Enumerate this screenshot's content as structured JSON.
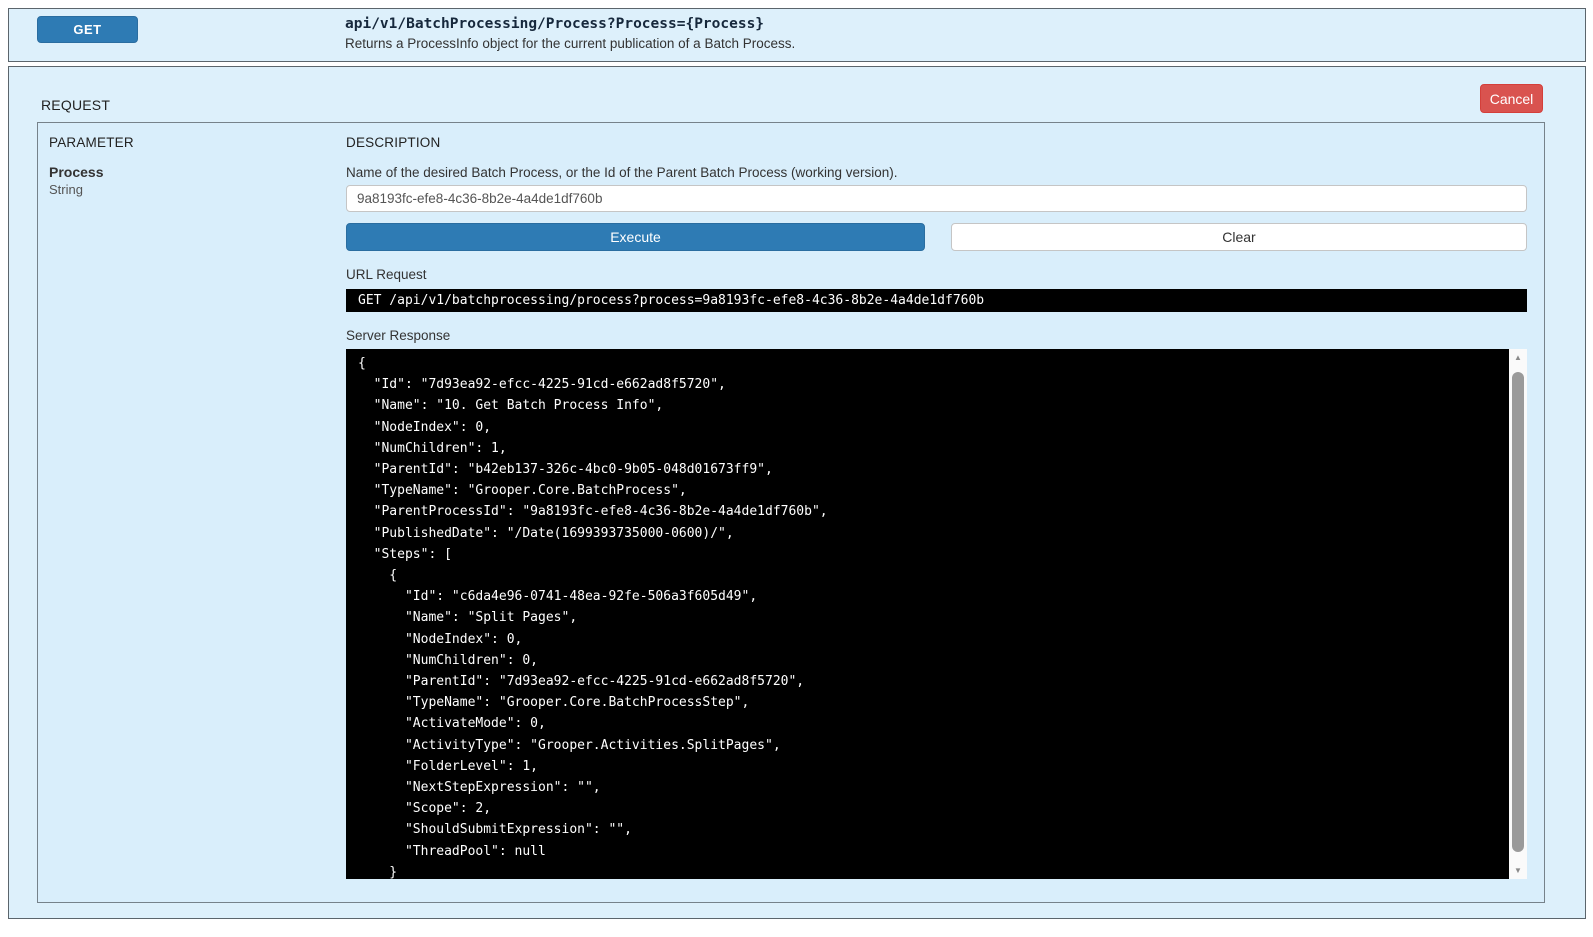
{
  "operation": {
    "method": "GET",
    "path": "api/v1/BatchProcessing/Process?Process={Process}",
    "summary": "Returns a ProcessInfo object for the current publication of a Batch Process."
  },
  "request": {
    "section_label": "REQUEST",
    "cancel_label": "Cancel",
    "table": {
      "parameter_header": "PARAMETER",
      "description_header": "DESCRIPTION",
      "parameter": {
        "name": "Process",
        "type": "String",
        "description": "Name of the desired Batch Process, or the Id of the Parent Batch Process (working version).",
        "value": "9a8193fc-efe8-4c36-8b2e-4a4de1df760b"
      }
    },
    "execute_label": "Execute",
    "clear_label": "Clear",
    "url_request_label": "URL Request",
    "url_request": "GET /api/v1/batchprocessing/process?process=9a8193fc-efe8-4c36-8b2e-4a4de1df760b",
    "server_response_label": "Server Response",
    "server_response_lines": [
      "{",
      "  \"Id\": \"7d93ea92-efcc-4225-91cd-e662ad8f5720\",",
      "  \"Name\": \"10. Get Batch Process Info\",",
      "  \"NodeIndex\": 0,",
      "  \"NumChildren\": 1,",
      "  \"ParentId\": \"b42eb137-326c-4bc0-9b05-048d01673ff9\",",
      "  \"TypeName\": \"Grooper.Core.BatchProcess\",",
      "  \"ParentProcessId\": \"9a8193fc-efe8-4c36-8b2e-4a4de1df760b\",",
      "  \"PublishedDate\": \"/Date(1699393735000-0600)/\",",
      "  \"Steps\": [",
      "    {",
      "      \"Id\": \"c6da4e96-0741-48ea-92fe-506a3f605d49\",",
      "      \"Name\": \"Split Pages\",",
      "      \"NodeIndex\": 0,",
      "      \"NumChildren\": 0,",
      "      \"ParentId\": \"7d93ea92-efcc-4225-91cd-e662ad8f5720\",",
      "      \"TypeName\": \"Grooper.Core.BatchProcessStep\",",
      "      \"ActivateMode\": 0,",
      "      \"ActivityType\": \"Grooper.Activities.SplitPages\",",
      "      \"FolderLevel\": 1,",
      "      \"NextStepExpression\": \"\",",
      "      \"Scope\": 2,",
      "      \"ShouldSubmitExpression\": \"\",",
      "      \"ThreadPool\": null",
      "    }"
    ]
  },
  "icons": {
    "scroll_up": "▲",
    "scroll_down": "▼"
  },
  "colors": {
    "panel_bg": "#ddf0fb",
    "accent_blue": "#2e7bb4",
    "cancel_red": "#d9534f",
    "console_bg": "#000000",
    "console_text": "#ffffff"
  }
}
